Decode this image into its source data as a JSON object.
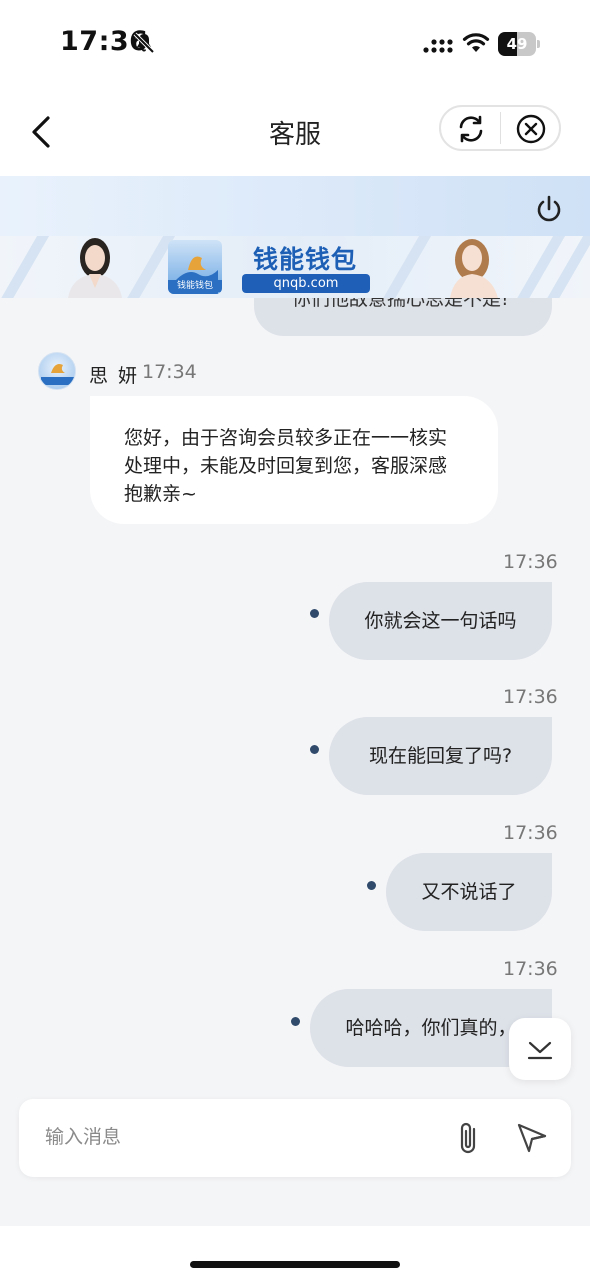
{
  "status_bar": {
    "time": "17:36",
    "battery": "49",
    "battery_level": 0.49
  },
  "nav": {
    "title": "客服"
  },
  "banner": {
    "brand": "钱能钱包",
    "url": "qnqb.com",
    "logo_text": "钱能钱包"
  },
  "messages": {
    "partial_text": "你们他敌意揣心思是不是!",
    "agent_name": "思 妍",
    "agent_time": "17:34",
    "agent_line1": "您好，由于咨询会员较多正在一一核实",
    "agent_line2": "处理中，未能及时回复到您，客服深感",
    "agent_line3": "抱歉亲~",
    "outgoing": [
      {
        "time": "17:36",
        "text": "你就会这一句话吗"
      },
      {
        "time": "17:36",
        "text": "现在能回复了吗?"
      },
      {
        "time": "17:36",
        "text": "又不说话了"
      },
      {
        "time": "17:36",
        "text": "哈哈哈，你们真的，"
      }
    ]
  },
  "composer": {
    "placeholder": "输入消息"
  },
  "icons": {
    "bell": "bell-slash-icon",
    "signal": "signal-icon",
    "wifi": "wifi-icon",
    "back": "chevron-left-icon",
    "refresh": "refresh-icon",
    "close": "close-circle-icon",
    "power": "power-icon",
    "scroll": "chevron-down-icon",
    "attach": "paperclip-icon",
    "send": "send-icon"
  },
  "colors": {
    "chat_bg": "#f4f5f7",
    "outgoing_bubble": "#dde1e8",
    "incoming_bubble": "#ffffff",
    "header_gradient_start": "#e9f2fc",
    "header_gradient_end": "#cfe1f6",
    "brand_blue": "#1d5fb5",
    "status_dot": "#2f4a6b"
  }
}
